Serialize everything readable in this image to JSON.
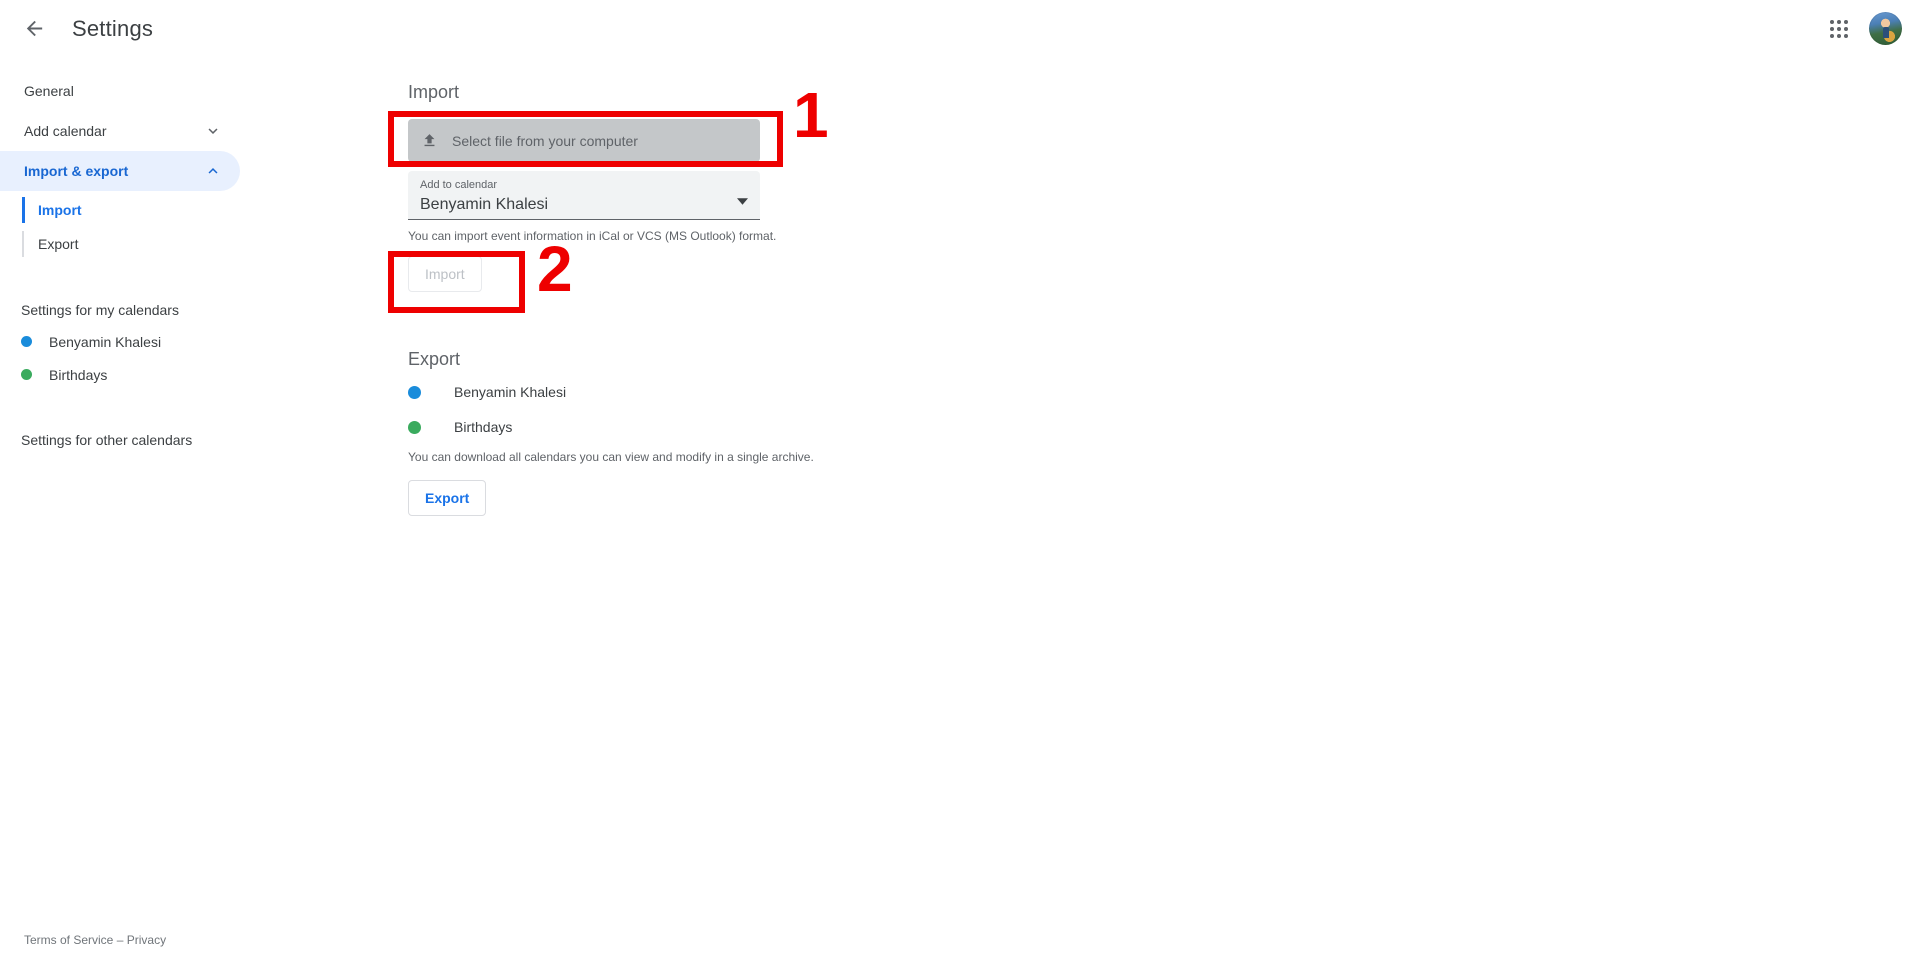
{
  "header": {
    "title": "Settings",
    "back_icon": "back-arrow-icon",
    "apps_icon": "apps-grid-icon",
    "avatar_alt": "account-avatar"
  },
  "sidebar": {
    "items": [
      {
        "label": "General",
        "expandable": false,
        "active": false
      },
      {
        "label": "Add calendar",
        "expandable": true,
        "chevron": "chevron-down",
        "active": false
      },
      {
        "label": "Import & export",
        "expandable": true,
        "chevron": "chevron-up",
        "active": true
      }
    ],
    "sub_items": [
      {
        "label": "Import",
        "active": true
      },
      {
        "label": "Export",
        "active": false
      }
    ],
    "my_calendars_title": "Settings for my calendars",
    "my_calendars": [
      {
        "label": "Benyamin Khalesi",
        "color": "#1a8cdb"
      },
      {
        "label": "Birthdays",
        "color": "#3aab5e"
      }
    ],
    "other_calendars_title": "Settings for other calendars"
  },
  "main": {
    "import": {
      "heading": "Import",
      "file_button_label": "Select file from your computer",
      "file_button_icon": "upload-icon",
      "select_label": "Add to calendar",
      "select_value": "Benyamin Khalesi",
      "select_icon": "dropdown-arrow-icon",
      "helper_text": "You can import event information in iCal or VCS (MS Outlook) format.",
      "submit_label": "Import"
    },
    "export": {
      "heading": "Export",
      "calendars": [
        {
          "label": "Benyamin Khalesi",
          "color": "#1a8cdb"
        },
        {
          "label": "Birthdays",
          "color": "#3aab5e"
        }
      ],
      "helper_text": "You can download all calendars you can view and modify in a single archive.",
      "button_label": "Export"
    }
  },
  "annotations": {
    "color": "#ee0000",
    "markers": [
      {
        "number": "1",
        "target": "select-file-button"
      },
      {
        "number": "2",
        "target": "import-submit-button"
      }
    ]
  },
  "footer": {
    "terms": "Terms of Service",
    "separator": "–",
    "privacy": "Privacy"
  }
}
